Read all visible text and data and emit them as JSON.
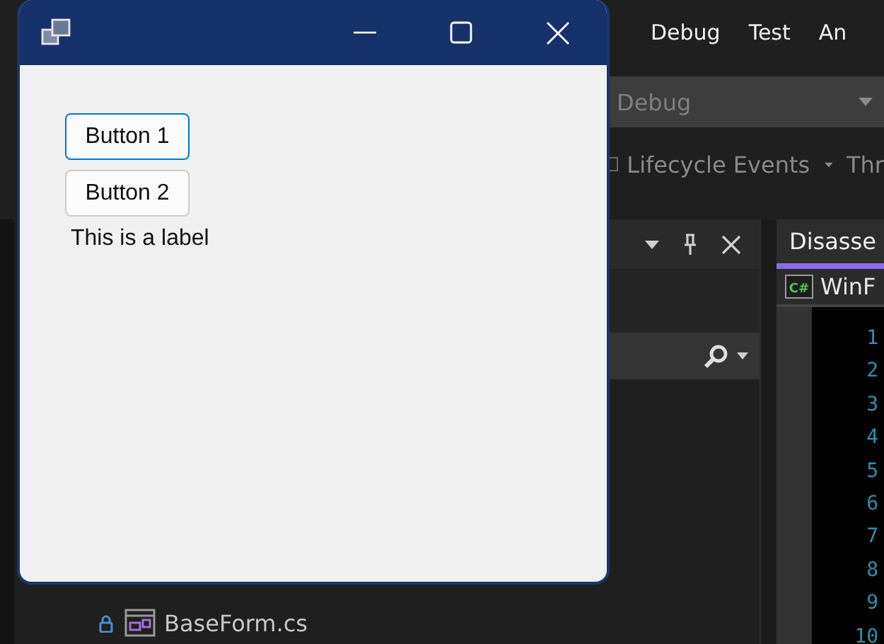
{
  "ide": {
    "menu": [
      "Debug",
      "Test",
      "An"
    ],
    "configuration": "Debug",
    "toolbar": {
      "label": "Lifecycle Events",
      "overflow": "Thr"
    },
    "solution_explorer": {
      "items": [
        {
          "name": "BaseForm.cs",
          "locked": true
        }
      ]
    },
    "editor": {
      "tab": "Disasse",
      "file_icon": "C#",
      "file": "WinF",
      "line_numbers": [
        "1",
        "2",
        "3",
        "4",
        "5",
        "6",
        "7",
        "8",
        "9",
        "10"
      ]
    }
  },
  "form": {
    "buttons": [
      {
        "label": "Button 1",
        "focused": true
      },
      {
        "label": "Button 2",
        "focused": false
      }
    ],
    "label": "This is a label"
  }
}
